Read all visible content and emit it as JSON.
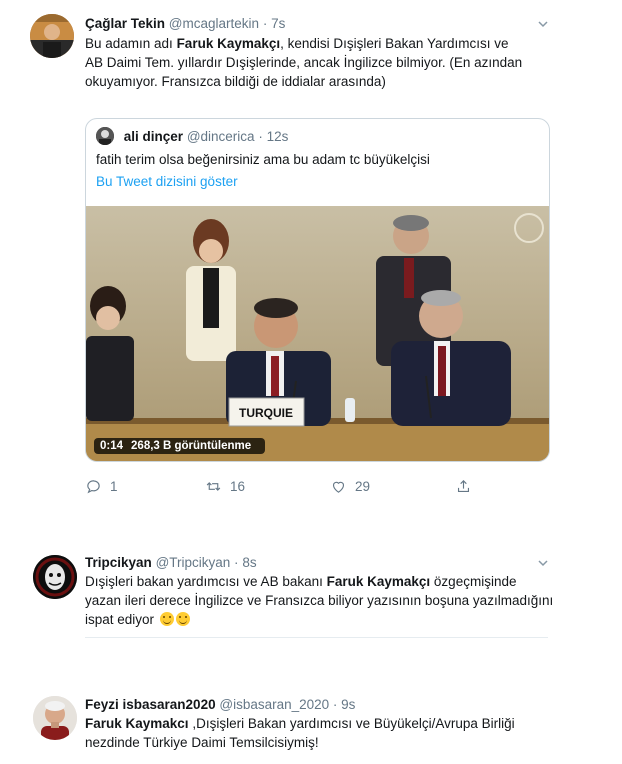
{
  "tweets": [
    {
      "name": "Çağlar Tekin",
      "handle": "@mcaglartekin",
      "dot": "·",
      "time": "7s",
      "text_pre": "Bu adamın adı ",
      "text_bold": "Faruk Kaymakçı",
      "text_post": ", kendisi Dışişleri Bakan Yardımcısı ve AB Daimi Tem. yıllardır Dışişlerinde, ancak İngilizce bilmiyor. (En azından okuyamıyor. Fransızca bildiği de iddialar arasında)",
      "quote": {
        "name": "ali dinçer",
        "handle": "@dincerica",
        "dot": "·",
        "time": "12s",
        "text": "fatih terim olsa beğenirsiniz ama bu adam tc büyükelçisi",
        "link": "Bu Tweet dizisini göster",
        "video_time": "0:14",
        "video_views": "268,3 B görüntülenme",
        "nameplate": "TURQUIE"
      },
      "actions": {
        "reply": "1",
        "retweet": "16",
        "like": "29"
      }
    },
    {
      "name": "Tripcikyan",
      "handle": "@Tripcikyan",
      "dot": "·",
      "time": "8s",
      "text_pre": "Dışişleri bakan yardımcısı ve AB bakanı ",
      "text_bold": "Faruk Kaymakçı",
      "text_post": " özgeçmişinde yazan ileri derece İngilizce ve Fransızca biliyor yazısının boşuna yazılmadığını ispat ediyor"
    },
    {
      "name": "Feyzi isbasaran2020",
      "handle": "@isbasaran_2020",
      "dot": "·",
      "time": "9s",
      "text_pre": "",
      "text_bold": "Faruk Kaymakcı",
      "text_post": " ,Dışişleri Bakan yardımcısı ve Büyükelçi/Avrupa Birliği nezdinde Türkiye Daimi Temsilcisiymiş!"
    }
  ]
}
